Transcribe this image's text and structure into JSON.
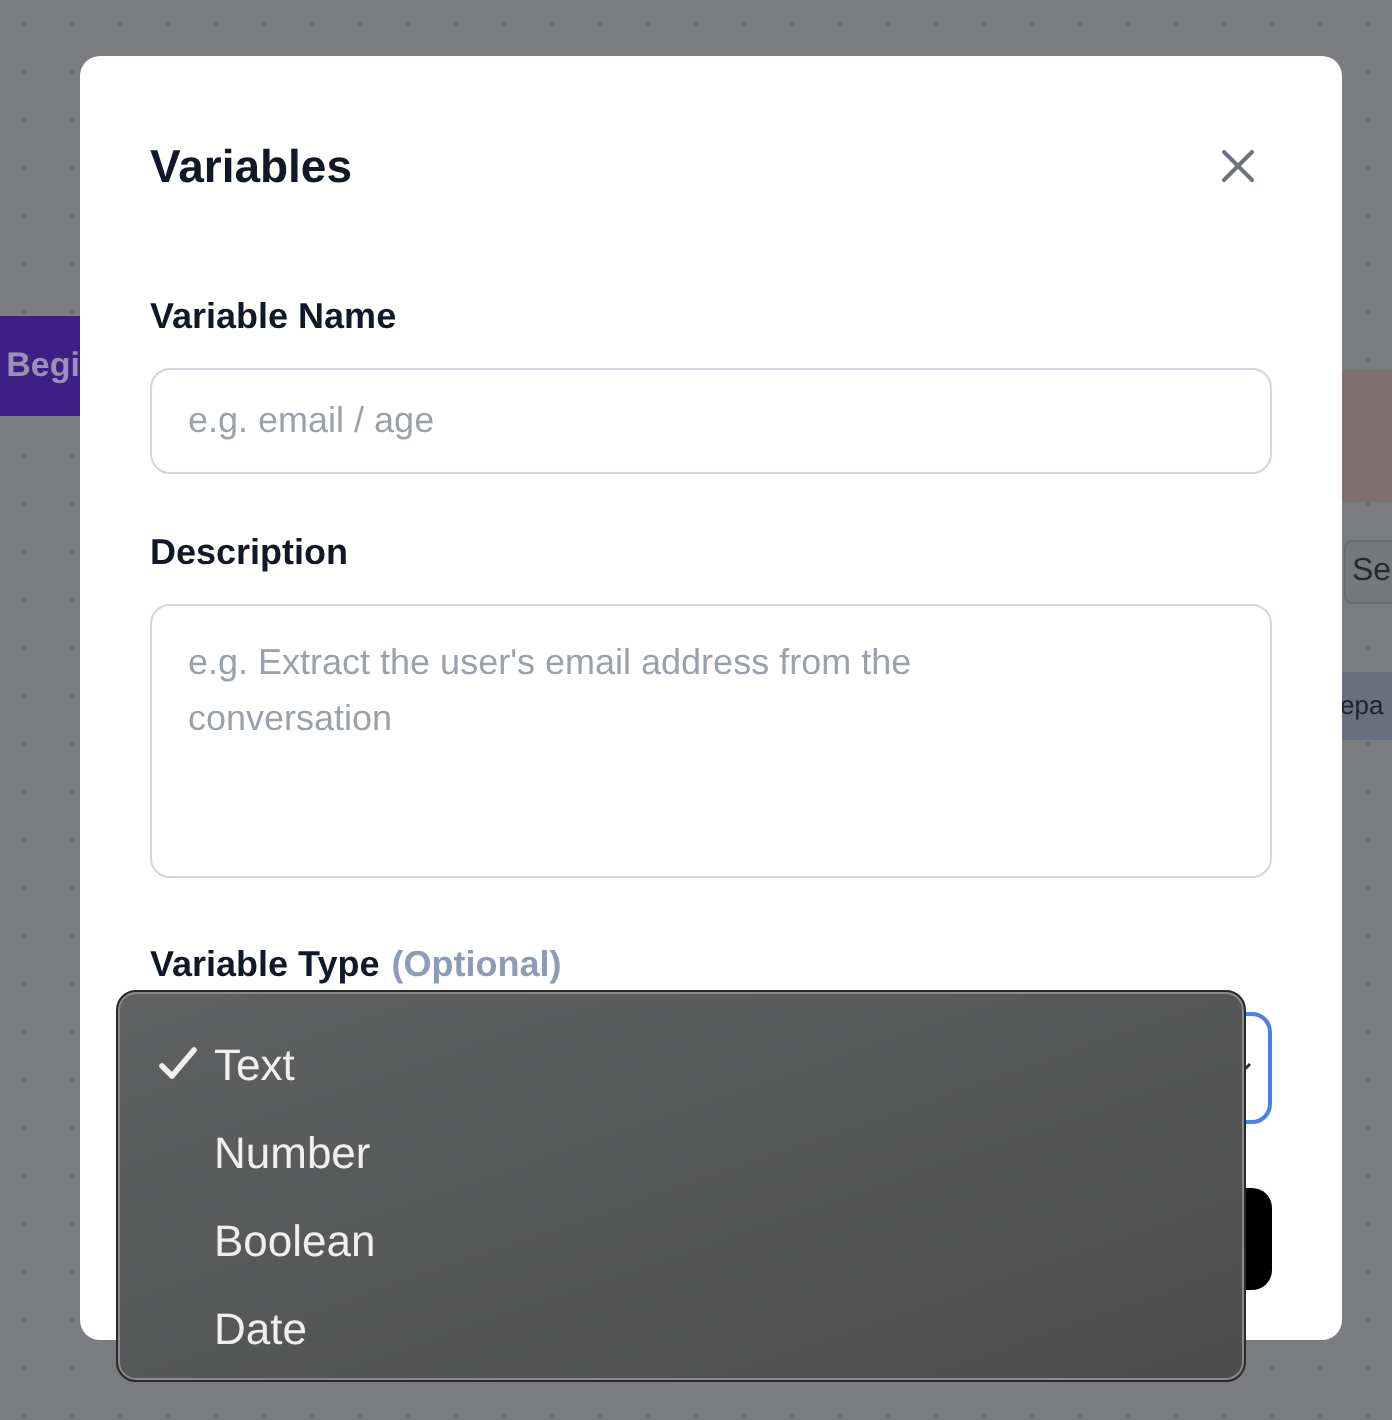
{
  "canvas": {
    "begin_node": "Begi",
    "side_button": "Se",
    "side_tag": "epa"
  },
  "dialog": {
    "title": "Variables",
    "name_field": {
      "label": "Variable Name",
      "placeholder": "e.g. email / age"
    },
    "description_field": {
      "label": "Description",
      "placeholder": "e.g. Extract the user's email address from the conversation"
    },
    "type_field": {
      "label": "Variable Type",
      "hint": "(Optional)",
      "focused": true,
      "options": [
        {
          "label": "Text",
          "selected": true
        },
        {
          "label": "Number",
          "selected": false
        },
        {
          "label": "Boolean",
          "selected": false
        },
        {
          "label": "Date",
          "selected": false
        }
      ]
    }
  }
}
